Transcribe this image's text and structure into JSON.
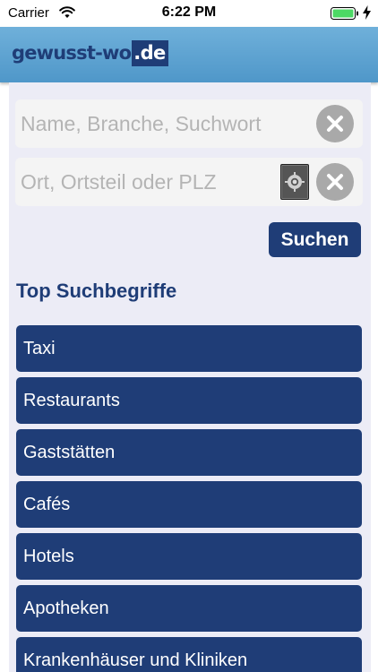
{
  "status_bar": {
    "carrier": "Carrier",
    "time": "6:22 PM",
    "icons": [
      "wifi-icon",
      "battery-icon",
      "charging-bolt-icon"
    ]
  },
  "header": {
    "logo_main": "gewusst-wo",
    "logo_tld": ".de",
    "colors": {
      "brand_dark": "#1f3d77",
      "header_bg": "#5aa3d2"
    }
  },
  "search": {
    "what_placeholder": "Name, Branche, Suchwort",
    "where_placeholder": "Ort, Ortsteil oder PLZ",
    "submit_label": "Suchen",
    "icons": [
      "clear-icon",
      "locate-icon"
    ]
  },
  "top_terms": {
    "title": "Top Suchbegriffe",
    "items": [
      {
        "label": "Taxi"
      },
      {
        "label": "Restaurants"
      },
      {
        "label": "Gaststätten"
      },
      {
        "label": "Cafés"
      },
      {
        "label": "Hotels"
      },
      {
        "label": "Apotheken"
      },
      {
        "label": "Krankenhäuser und Kliniken"
      }
    ]
  }
}
